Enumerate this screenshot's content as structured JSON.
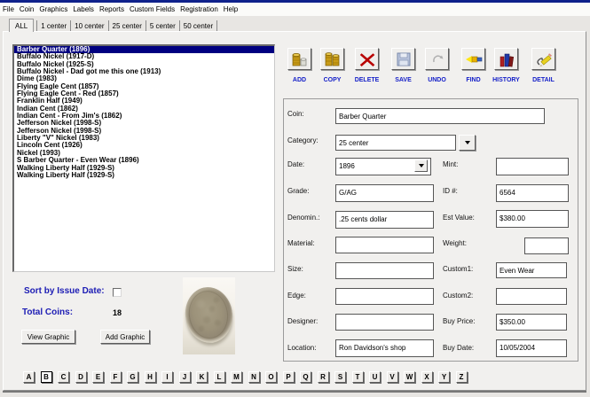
{
  "menu": {
    "items": [
      "File",
      "Coin",
      "Graphics",
      "Labels",
      "Reports",
      "Custom Fields",
      "Registration",
      "Help"
    ]
  },
  "tabs": {
    "items": [
      "ALL",
      "1 center",
      "10 center",
      "25 center",
      "5 center",
      "50 center"
    ],
    "active_index": 0
  },
  "coin_list": {
    "items": [
      "Barber Quarter (1896)",
      "Buffalo Nickel (1917-D)",
      "Buffalo Nickel (1925-S)",
      "Buffalo Nickel - Dad got me this one (1913)",
      "Dime (1983)",
      "Flying Eagle Cent (1857)",
      "Flying Eagle Cent - Red (1857)",
      "Franklin Half (1949)",
      "Indian Cent (1862)",
      "Indian Cent - From Jim's (1862)",
      "Jefferson Nickel (1998-S)",
      "Jefferson Nickel (1998-S)",
      "Liberty \"V\" Nickel (1983)",
      "Lincoln Cent (1926)",
      "Nickel (1993)",
      "S Barber Quarter - Even Wear (1896)",
      "Walking Liberty Half (1929-S)",
      "Walking Liberty Half (1929-S)"
    ],
    "selected_index": 0
  },
  "toolbar": {
    "buttons": [
      {
        "label": "ADD"
      },
      {
        "label": "COPY"
      },
      {
        "label": "DELETE"
      },
      {
        "label": "SAVE"
      },
      {
        "label": "UNDO"
      },
      {
        "label": "FIND"
      },
      {
        "label": "HISTORY"
      },
      {
        "label": "DETAIL"
      }
    ]
  },
  "form": {
    "fields": {
      "coin": {
        "label": "Coin:",
        "value": "Barber Quarter"
      },
      "category": {
        "label": "Category:",
        "value": "25 center"
      },
      "date": {
        "label": "Date:",
        "value": "1896"
      },
      "mint": {
        "label": "Mint:",
        "value": ""
      },
      "grade": {
        "label": "Grade:",
        "value": "G/AG"
      },
      "id": {
        "label": "ID #:",
        "value": "6564"
      },
      "denomination": {
        "label": "Denomin.:",
        "value": ".25 cents dollar"
      },
      "est_value": {
        "label": "Est Value:",
        "value": "$380.00"
      },
      "material": {
        "label": "Material:",
        "value": ""
      },
      "weight": {
        "label": "Weight:",
        "value": ""
      },
      "size": {
        "label": "Size:",
        "value": ""
      },
      "custom1": {
        "label": "Custom1:",
        "value": "Even Wear"
      },
      "edge": {
        "label": "Edge:",
        "value": ""
      },
      "custom2": {
        "label": "Custom2:",
        "value": ""
      },
      "designer": {
        "label": "Designer:",
        "value": ""
      },
      "buy_price": {
        "label": "Buy Price:",
        "value": "$350.00"
      },
      "location": {
        "label": "Location:",
        "value": "Ron Davidson's shop"
      },
      "buy_date": {
        "label": "Buy Date:",
        "value": "10/05/2004"
      }
    }
  },
  "summary": {
    "sort_label": "Sort by Issue Date:",
    "total_label": "Total Coins:",
    "total_value": "18",
    "view_graphic": "View Graphic",
    "add_graphic": "Add Graphic"
  },
  "alphabet": {
    "letters": [
      "A",
      "B",
      "C",
      "D",
      "E",
      "F",
      "G",
      "H",
      "I",
      "J",
      "K",
      "L",
      "M",
      "N",
      "O",
      "P",
      "Q",
      "R",
      "S",
      "T",
      "U",
      "V",
      "W",
      "X",
      "Y",
      "Z"
    ],
    "focused_index": 1
  },
  "colors": {
    "selection": "#000080",
    "label_blue": "#1c1cb4",
    "toolbar_label": "#1520c8",
    "title_strip": "#0f218b"
  }
}
